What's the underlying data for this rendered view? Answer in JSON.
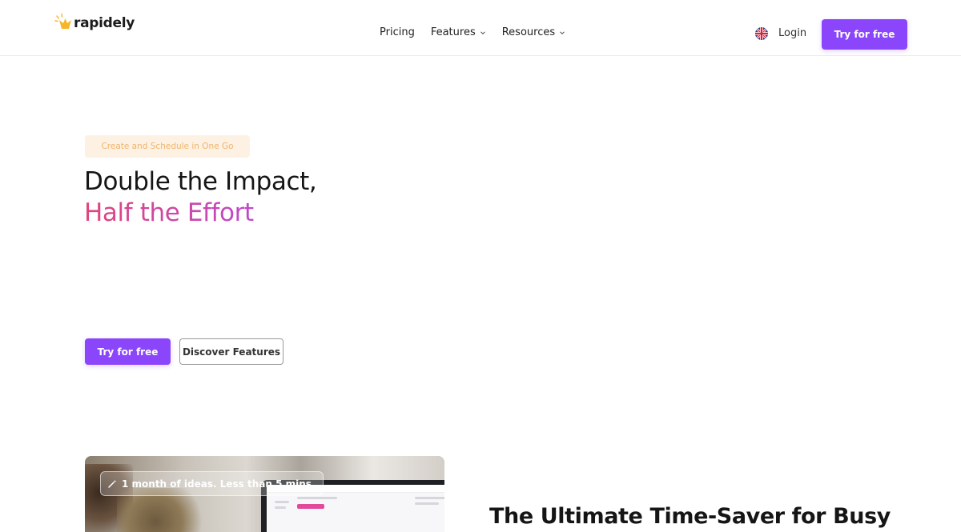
{
  "header": {
    "logo_text": "rapidely",
    "nav": {
      "pricing": "Pricing",
      "features": "Features",
      "resources": "Resources"
    },
    "login": "Login",
    "cta": "Try for free"
  },
  "hero": {
    "tagline": "Create and Schedule in One Go",
    "title_line1": "Double the Impact,",
    "title_line2": "Half the Effort",
    "cta_primary": "Try for free",
    "cta_secondary": "Discover Features"
  },
  "media": {
    "pill_text": "1 month of ideas. Less than 5 mins."
  },
  "section": {
    "title": "The Ultimate Time-Saver for Busy"
  },
  "colors": {
    "brand": "#8b46fb",
    "tagline_bg": "#fdf1e3",
    "tagline_text": "#f0b46a",
    "gradient_start": "#e0457a",
    "gradient_end": "#b24be8"
  },
  "icons": [
    "logo-mark-icon",
    "chevron-down-icon",
    "uk-flag-icon",
    "magic-wand-icon"
  ]
}
